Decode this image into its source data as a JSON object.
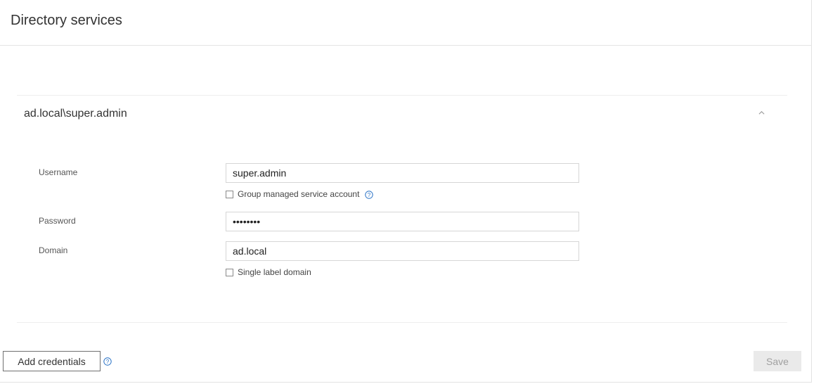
{
  "page": {
    "title": "Directory services"
  },
  "credential_panel": {
    "title": "ad.local\\super.admin",
    "expanded": true,
    "fields": {
      "username": {
        "label": "Username",
        "value": "super.admin"
      },
      "gmsa": {
        "label": "Group managed service account",
        "checked": false
      },
      "password": {
        "label": "Password",
        "value": "••••••••"
      },
      "domain": {
        "label": "Domain",
        "value": "ad.local"
      },
      "single_label": {
        "label": "Single label domain",
        "checked": false
      }
    }
  },
  "footer": {
    "add_credentials_label": "Add credentials",
    "save_label": "Save",
    "save_enabled": false
  },
  "colors": {
    "accent": "#2b73c6",
    "divider": "#e4e4e4",
    "disabled_bg": "#eaeaea",
    "disabled_text": "#a0a0a0"
  },
  "icons": {
    "help": "question-circle-icon",
    "collapse": "chevron-up-icon"
  }
}
